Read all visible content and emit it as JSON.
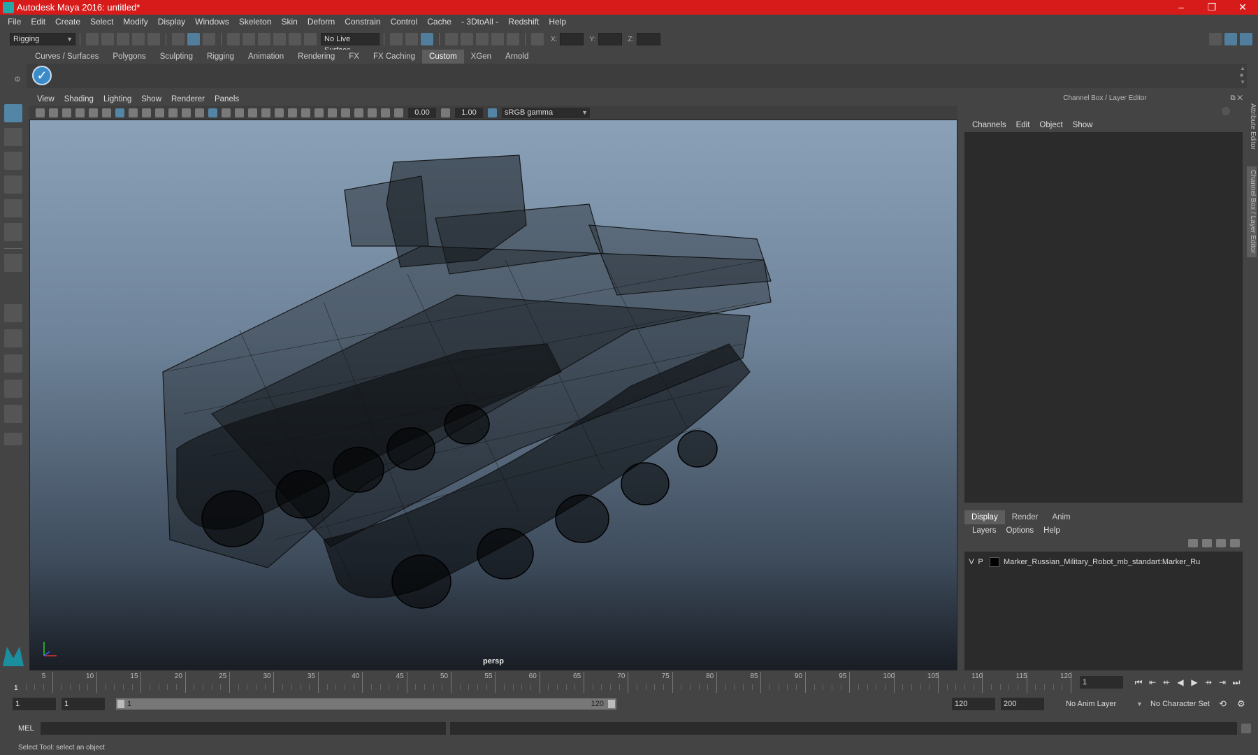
{
  "window": {
    "title": "Autodesk Maya 2016: untitled*",
    "controls": [
      "–",
      "❐",
      "✕"
    ]
  },
  "menubar": [
    "File",
    "Edit",
    "Create",
    "Select",
    "Modify",
    "Display",
    "Windows",
    "Skeleton",
    "Skin",
    "Deform",
    "Constrain",
    "Control",
    "Cache",
    "- 3DtoAll -",
    "Redshift",
    "Help"
  ],
  "toolbar": {
    "menuset": "Rigging",
    "live_surface": "No Live Surface",
    "x_label": "X:",
    "y_label": "Y:",
    "z_label": "Z:"
  },
  "shelf": {
    "tabs": [
      "Curves / Surfaces",
      "Polygons",
      "Sculpting",
      "Rigging",
      "Animation",
      "Rendering",
      "FX",
      "FX Caching",
      "Custom",
      "XGen",
      "Arnold"
    ],
    "active_tab": "Custom"
  },
  "viewport": {
    "menu": [
      "View",
      "Shading",
      "Lighting",
      "Show",
      "Renderer",
      "Panels"
    ],
    "exposure": "0.00",
    "gamma": "1.00",
    "color_space": "sRGB gamma",
    "camera_label": "persp"
  },
  "channel_box": {
    "title": "Channel Box / Layer Editor",
    "menu": [
      "Channels",
      "Edit",
      "Object",
      "Show"
    ]
  },
  "layer_editor": {
    "tabs": [
      "Display",
      "Render",
      "Anim"
    ],
    "active_tab": "Display",
    "menu": [
      "Layers",
      "Options",
      "Help"
    ],
    "layers": [
      {
        "v": "V",
        "p": "P",
        "name": "Marker_Russian_Military_Robot_mb_standart:Marker_Ru"
      }
    ]
  },
  "side_tabs": [
    "Attribute Editor",
    "Channel Box / Layer Editor"
  ],
  "timeline": {
    "ticks": [
      1,
      5,
      10,
      15,
      20,
      25,
      30,
      35,
      40,
      45,
      50,
      55,
      60,
      65,
      70,
      75,
      80,
      85,
      90,
      95,
      100,
      105,
      110,
      115,
      120
    ],
    "current_frame": "1",
    "current_frame_field": "1"
  },
  "range": {
    "start_field": "1",
    "start2_field": "1",
    "slider_start": "1",
    "slider_end": "120",
    "end_field": "120",
    "end2_field": "200",
    "anim_layer": "No Anim Layer",
    "character_set": "No Character Set"
  },
  "command": {
    "label": "MEL"
  },
  "status": {
    "text": "Select Tool: select an object"
  }
}
